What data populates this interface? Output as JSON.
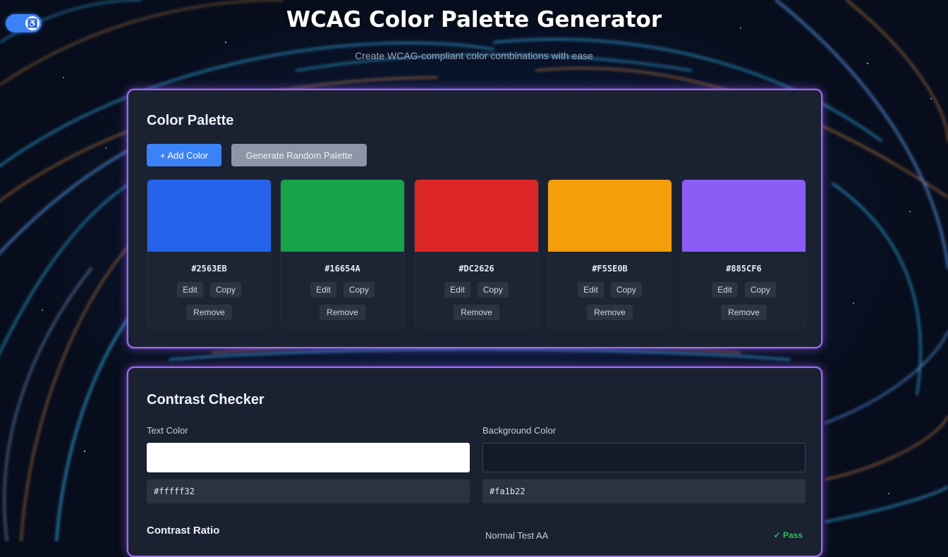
{
  "header": {
    "title": "WCAG Color Palette Generator",
    "subtitle": "Create WCAG-compliant color combinations with ease",
    "toggle_icon": "accessibility-icon",
    "toggle_state": true
  },
  "palette": {
    "title": "Color Palette",
    "add_label": "+ Add Color",
    "random_label": "Generate Random Palette",
    "colors": [
      {
        "hex": "#2563EB",
        "swatch": "#2563EB",
        "edit": "Edit",
        "copy": "Copy",
        "remove": "Remove"
      },
      {
        "hex": "#16654A",
        "swatch": "#16A34A",
        "edit": "Edit",
        "copy": "Copy",
        "remove": "Remove"
      },
      {
        "hex": "#DC2626",
        "swatch": "#DC2626",
        "edit": "Edit",
        "copy": "Copy",
        "remove": "Remove"
      },
      {
        "hex": "#F5SE0B",
        "swatch": "#F59E0B",
        "edit": "Edit",
        "copy": "Copy",
        "remove": "Remove"
      },
      {
        "hex": "#885CF6",
        "swatch": "#8B5CF6",
        "edit": "Edit",
        "copy": "Copy",
        "remove": "Remove"
      }
    ]
  },
  "contrast": {
    "title": "Contrast Checker",
    "text_color_label": "Text Color",
    "background_color_label": "Background Color",
    "text_swatch": "#ffffff",
    "background_swatch": "#0f1a22",
    "text_hex": "#fffff32",
    "background_hex": "#fa1b22",
    "ratio_label": "Contrast Ratio",
    "check_label": "Normal Test AA",
    "check_status": "✓ Pass"
  },
  "colors": {
    "accent": "#3b82f6",
    "card_border": "#a06bf0",
    "pass": "#22c55e"
  }
}
